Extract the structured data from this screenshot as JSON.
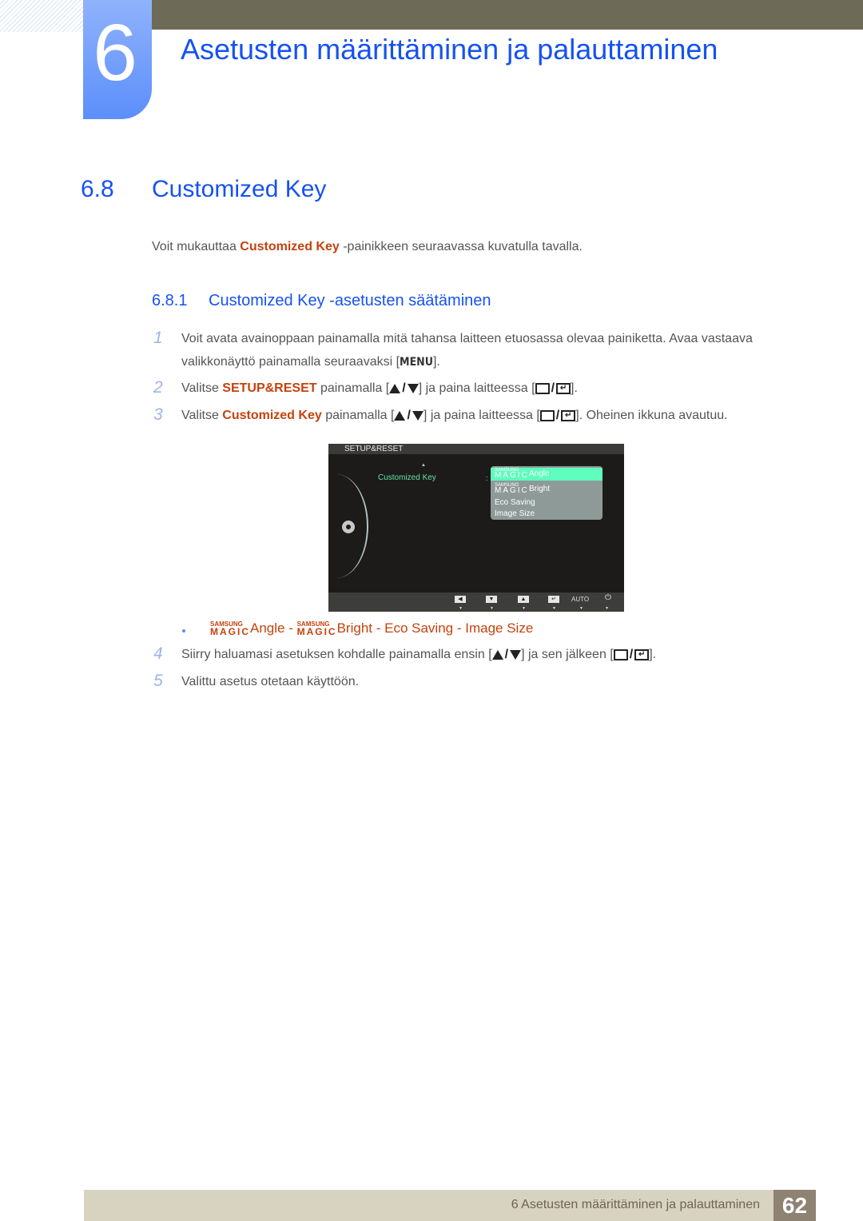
{
  "chapter": {
    "number": "6",
    "title": "Asetusten määrittäminen ja palauttaminen"
  },
  "section": {
    "number": "6.8",
    "title": "Customized Key",
    "intro_pre": "Voit mukauttaa ",
    "intro_hl": "Customized Key",
    "intro_post": " -painikkeen seuraavassa kuvatulla tavalla."
  },
  "subsection": {
    "number": "6.8.1",
    "title": "Customized Key -asetusten säätäminen"
  },
  "steps": [
    {
      "num": "1",
      "line1": "Voit avata avainoppaan painamalla mitä tahansa laitteen etuosassa olevaa painiketta. Avaa vastaava",
      "line2_pre": "valikkonäyttö painamalla seuraavaksi [",
      "key": "MENU",
      "line2_post": "]."
    },
    {
      "num": "2",
      "pre": "Valitse ",
      "hl": "SETUP&RESET",
      "mid": " painamalla [",
      "mid2": "] ja paina laitteessa [",
      "post": "]."
    },
    {
      "num": "3",
      "pre": "Valitse ",
      "hl": "Customized Key",
      "mid": " painamalla [",
      "mid2": "] ja paina laitteessa [",
      "post": "]. Oheinen ikkuna avautuu."
    },
    {
      "num": "4",
      "pre": "Siirry haluamasi asetuksen kohdalle painamalla ensin [",
      "mid2": "] ja sen jälkeen [",
      "post": "]."
    },
    {
      "num": "5",
      "text": "Valittu asetus otetaan käyttöön."
    }
  ],
  "osd": {
    "header": "SETUP&RESET",
    "item": "Customized Key",
    "colon": ":",
    "options": [
      {
        "brand_top": "SAMSUNG",
        "brand_bottom": "MAGIC",
        "label": "Angle",
        "selected": true
      },
      {
        "brand_top": "SAMSUNG",
        "brand_bottom": "MAGIC",
        "label": "Bright",
        "selected": false
      },
      {
        "label": "Eco Saving",
        "selected": false
      },
      {
        "label": "Image Size",
        "selected": false
      }
    ],
    "buttons": [
      "◀",
      "▼",
      "▲",
      "↵",
      "AUTO",
      "⏻"
    ],
    "button_names": [
      "left-icon",
      "down-icon",
      "up-icon",
      "enter-icon",
      "auto-button",
      "power-icon"
    ]
  },
  "options_line": {
    "brand_top": "SAMSUNG",
    "brand_bottom": "MAGIC",
    "items": [
      "Angle",
      "Bright",
      "Eco Saving",
      "Image Size"
    ],
    "separator": " - "
  },
  "footer": {
    "text": "6 Asetusten määrittäminen ja palauttaminen",
    "page": "62"
  },
  "colors": {
    "heading_blue": "#1652f2",
    "highlight_orange": "#c4420d",
    "osd_selected": "#5ffdbd"
  }
}
